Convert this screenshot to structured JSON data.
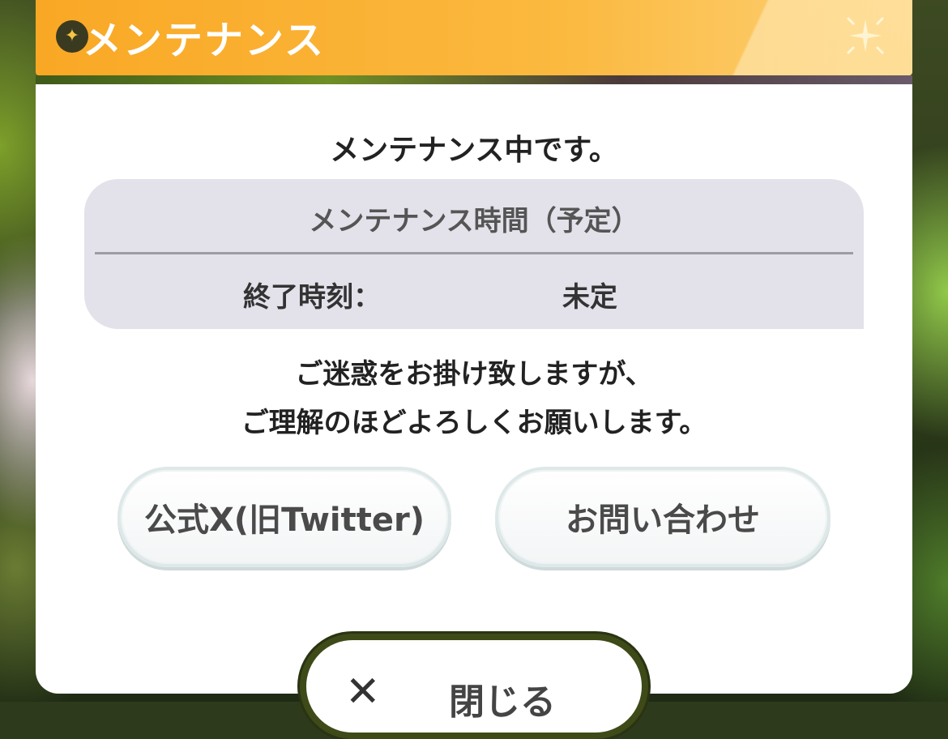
{
  "dialog": {
    "title": "メンテナンス",
    "heading": "メンテナンス中です。",
    "schedule": {
      "title": "メンテナンス時間（予定）",
      "end_label": "終了時刻：",
      "end_value": "未定"
    },
    "message_line1": "ご迷惑をお掛け致しますが、",
    "message_line2": "ご理解のほどよろしくお願いします。",
    "buttons": {
      "official_x": "公式X(旧Twitter)",
      "inquiry": "お問い合わせ",
      "close": "閉じる"
    },
    "icons": {
      "title_star": "star-icon",
      "sparkle": "sparkle-icon",
      "close": "close-icon"
    },
    "colors": {
      "title_bar": "#f9a825",
      "panel": "#ffffff",
      "info_box": "#e3e2ea"
    }
  }
}
